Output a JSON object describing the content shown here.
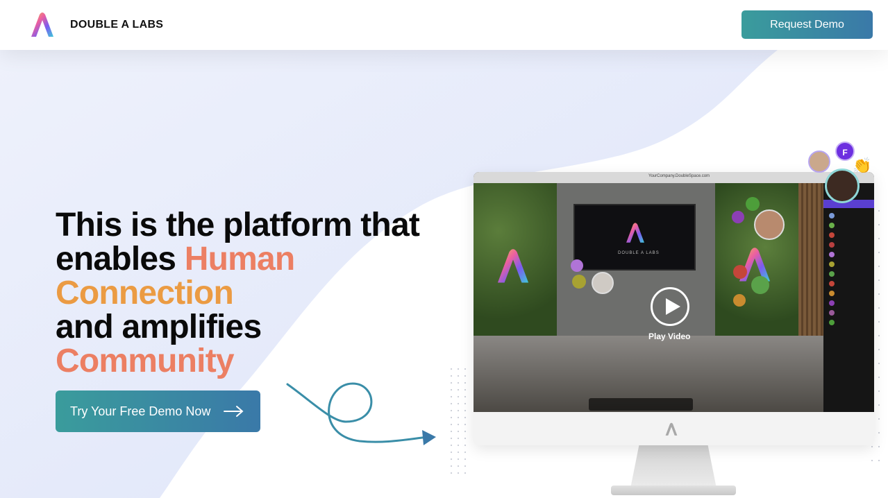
{
  "header": {
    "brand": "DOUBLE A LABS",
    "request_demo": "Request Demo"
  },
  "hero": {
    "line1": "This is the platform that",
    "line2_prefix": "enables ",
    "line2_highlight": "Human",
    "line3_highlight": "Connection",
    "line4": "and amplifies",
    "line5_highlight": "Community",
    "cta_label": "Try Your Free Demo Now"
  },
  "preview": {
    "url": "YourCompany.DoubleSpace.com",
    "tv_text": "DOUBLE A LABS",
    "play_label": "Play Video",
    "avatar_initial": "F"
  },
  "colors": {
    "accent_teal": "#3a9c9c",
    "accent_blue": "#3a79a8",
    "highlight_coral": "#ec7f63",
    "highlight_orange": "#eb9b43"
  }
}
